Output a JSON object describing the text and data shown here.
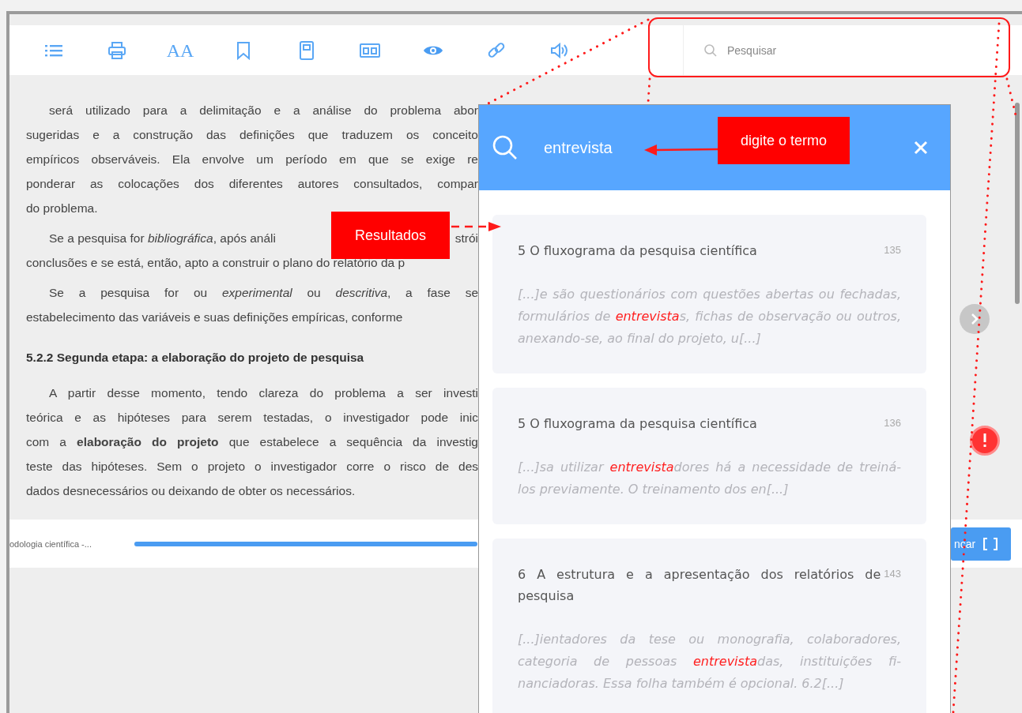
{
  "toolbar": {
    "items": [
      {
        "kind": "list"
      },
      {
        "kind": "print"
      },
      {
        "kind": "text",
        "label": "AA"
      },
      {
        "kind": "bookmark"
      },
      {
        "kind": "notebook"
      },
      {
        "kind": "layout"
      },
      {
        "kind": "eye"
      },
      {
        "kind": "link"
      },
      {
        "kind": "audio"
      }
    ],
    "search": {
      "placeholder": "Pesquisar"
    }
  },
  "reader": {
    "blocks": [
      {
        "kind": "paragraph",
        "lines": [
          {
            "text": "será utilizado para a delimitação e a análise do problema abor"
          },
          {
            "text": "sugeridas e a construção das definições que traduzem os conceito"
          },
          {
            "text": "empíricos observáveis. Ela envolve um período em que se exige re"
          },
          {
            "text": "ponderar as colocações dos diferentes autores consultados, compar"
          },
          {
            "text": "do problema."
          }
        ]
      },
      {
        "kind": "paragraph",
        "lines": [
          {
            "text": "Se a pesquisa for *bibliográfica*, após análi",
            "tail": "strói"
          },
          {
            "text": "conclusões e se está, então, apto a construir o plano do relatório da p"
          }
        ]
      },
      {
        "kind": "paragraph",
        "lines": [
          {
            "text": "Se a pesquisa for ou *experimental* ou *descritiva*, a fase se"
          },
          {
            "text": "estabelecimento das variáveis e suas definições empíricas, conforme"
          }
        ]
      },
      {
        "kind": "heading",
        "text": "5.2.2 Segunda etapa: a elaboração do projeto de pesquisa"
      },
      {
        "kind": "paragraph",
        "lines": [
          {
            "text": "A partir desse momento, tendo clareza do problema a ser investi"
          },
          {
            "text": "teórica e as hipóteses para serem testadas, o investigador pode inic"
          },
          {
            "text": "com a **elaboração do projeto** que estabelece a sequência da investig"
          },
          {
            "text": "teste das hipóteses. Sem o projeto o investigador corre o risco de des"
          },
          {
            "text": "dados desnecessários ou deixando de obter os necessários."
          }
        ]
      }
    ]
  },
  "bottom_bar": {
    "book_title": "odologia científica -...",
    "level": 1,
    "button": "ncar"
  },
  "search_panel": {
    "value": "entrevista",
    "results": [
      {
        "title": "5 O fluxograma da pesquisa científica",
        "page": "135",
        "snippet": [
          {
            "text": "[...]e são questionários com questões abertas ou fechadas, formulários de ",
            "match": false
          },
          {
            "text": "entrevista",
            "match": true
          },
          {
            "text": "s, fichas de observação ou outros, anexando-se, ao final do projeto, u[...]",
            "match": false
          }
        ]
      },
      {
        "title": "5 O fluxograma da pesquisa científica",
        "page": "136",
        "snippet": [
          {
            "text": "[...]sa utilizar ",
            "match": false
          },
          {
            "text": "entrevista",
            "match": true
          },
          {
            "text": "dores há a necessidade de treiná-los previamente. O treinamento dos en[...]",
            "match": false
          }
        ]
      },
      {
        "title": "6 A estrutura e a apresentação dos relatórios de pesquisa",
        "page": "143",
        "snippet": [
          {
            "text": "[...]ientadores da tese ou monografia, colaboradores, categoria de pessoas ",
            "match": false
          },
          {
            "text": "entrevista",
            "match": true
          },
          {
            "text": "das, instituições fi-nanciadoras. Essa folha também é opcional. 6.2[...]",
            "match": false
          }
        ]
      }
    ]
  },
  "annotations": [
    {
      "text": "digite o termo"
    },
    {
      "text": "Resultados"
    }
  ]
}
